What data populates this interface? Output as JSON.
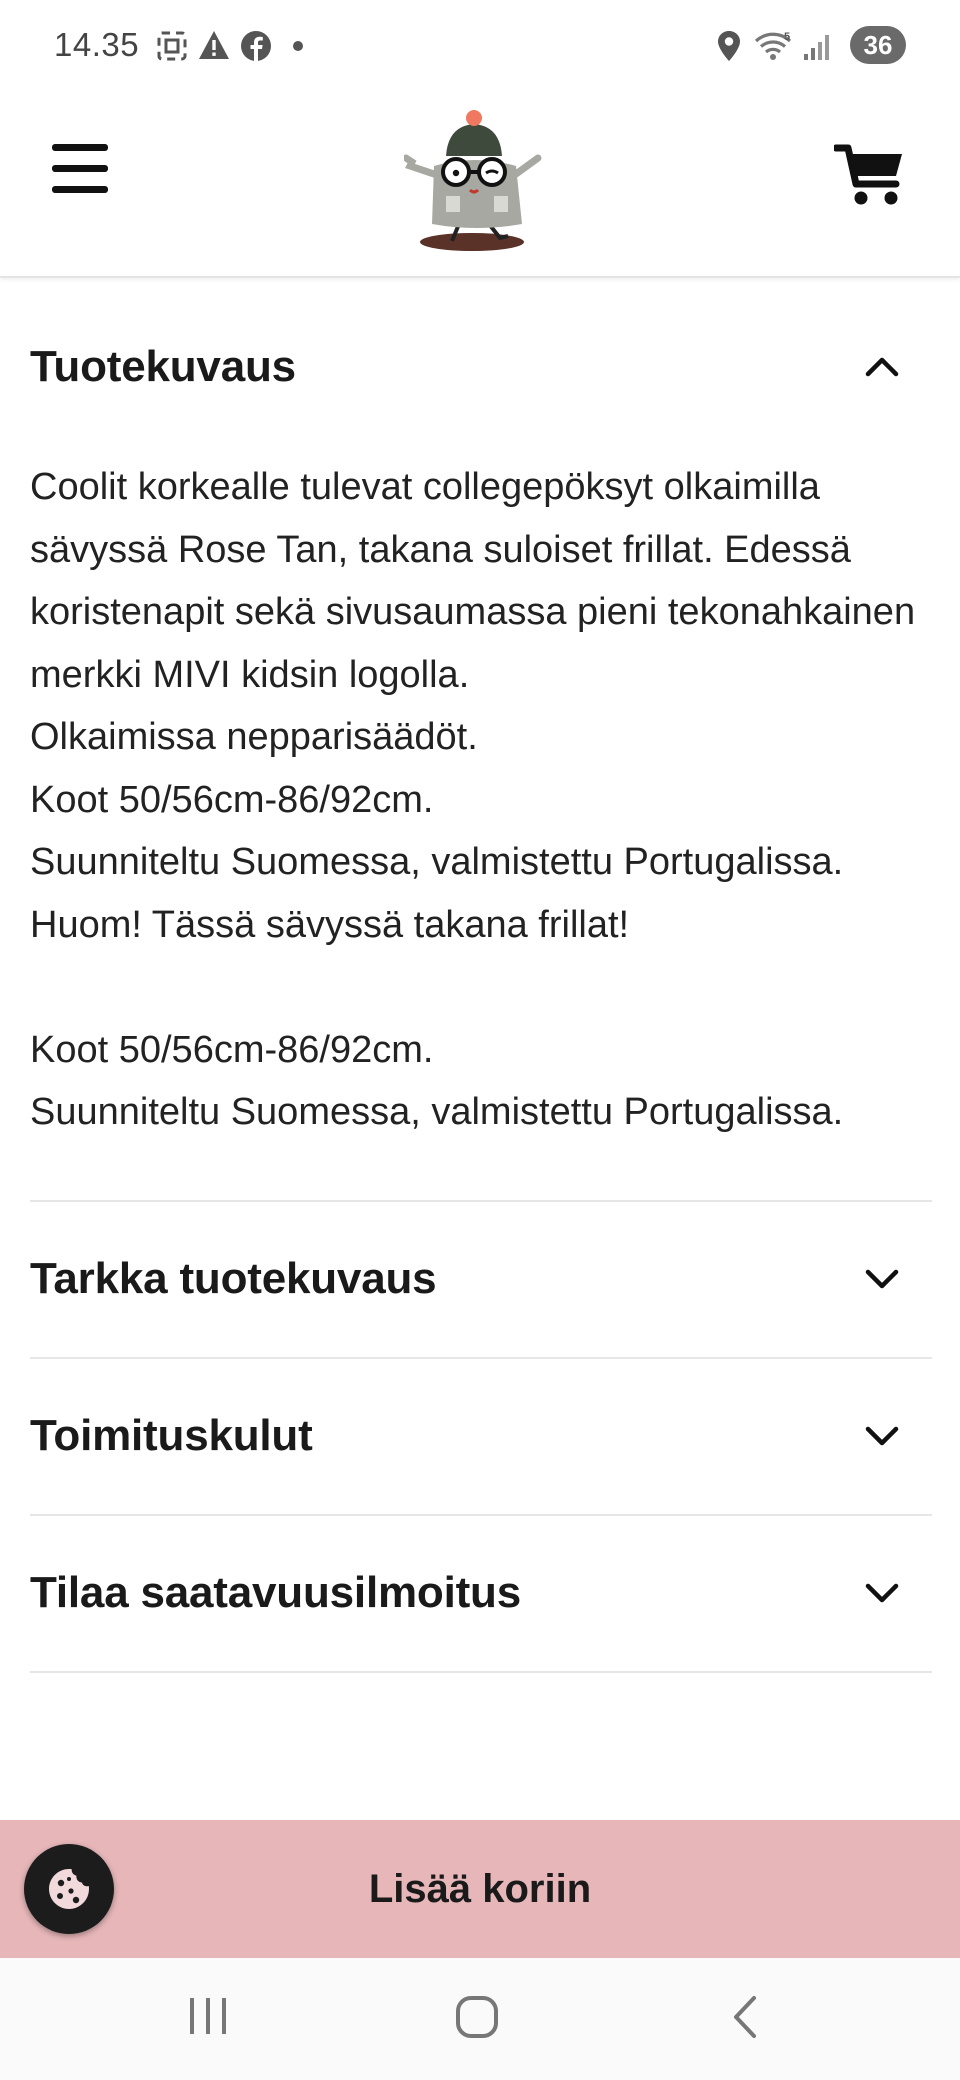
{
  "status_bar": {
    "time": "14.35",
    "battery": "36",
    "wifi_label": "5"
  },
  "header": {
    "menu_icon": "hamburger-icon",
    "logo_icon": "mascot-logo",
    "cart_icon": "shopping-cart-icon"
  },
  "accordion": {
    "sections": [
      {
        "title": "Tuotekuvaus",
        "expanded": true,
        "body": "Coolit korkealle tulevat collegepöksyt olkaimilla sävyssä Rose Tan, takana suloiset frillat. Edessä koristenapit sekä sivusaumassa pieni tekonahkainen merkki MIVI kidsin logolla.\nOlkaimissa nepparisäädöt.\nKoot 50/56cm-86/92cm.\nSuunniteltu Suomessa, valmistettu Portugalissa.\nHuom! Tässä sävyssä takana frillat!\n\nKoot 50/56cm-86/92cm.\nSuunniteltu Suomessa, valmistettu Portugalissa."
      },
      {
        "title": "Tarkka tuotekuvaus",
        "expanded": false
      },
      {
        "title": "Toimituskulut",
        "expanded": false
      },
      {
        "title": "Tilaa saatavuusilmoitus",
        "expanded": false
      }
    ]
  },
  "add_to_cart": {
    "label": "Lisää koriin",
    "background": "#e6b6b9"
  },
  "cookie_button": {
    "icon": "cookie-icon"
  },
  "nav_bar": {
    "recents_icon": "recents-icon",
    "home_icon": "home-icon",
    "back_icon": "back-icon"
  }
}
